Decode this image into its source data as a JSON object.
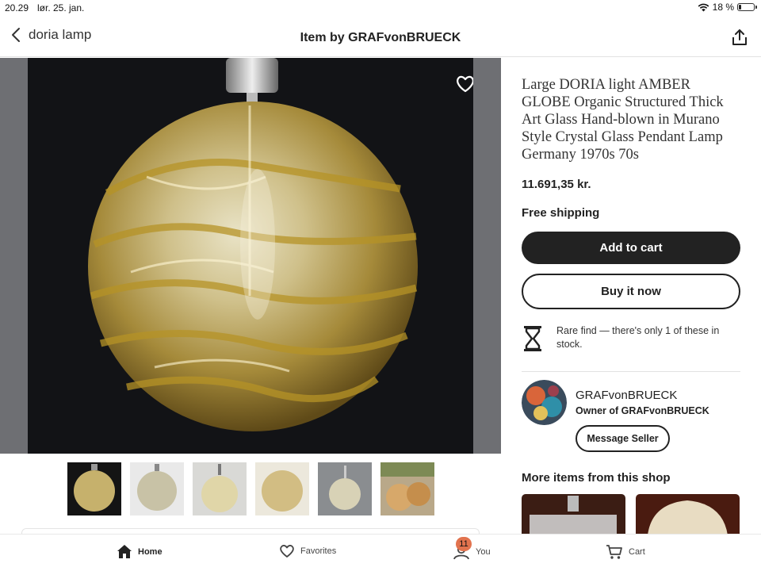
{
  "status_bar": {
    "time": "20.29",
    "date": "lør. 25. jan.",
    "battery_text": "18 %",
    "battery_level": 0.18
  },
  "header": {
    "back_label": "doria lamp",
    "title": "Item by GRAFvonBRUECK"
  },
  "product": {
    "title": "Large DORIA light AMBER GLOBE Organic Structured Thick Art Glass Hand-blown in Murano Style Crystal Glass  Pendant Lamp Germany 1970s 70s",
    "price": "11.691,35 kr.",
    "shipping": "Free shipping",
    "thumbnail_count": 6
  },
  "actions": {
    "add_to_cart": "Add to cart",
    "buy_now": "Buy it now"
  },
  "rare_notice": "Rare find — there's only 1 of these in stock.",
  "seller": {
    "name": "GRAFvonBRUECK",
    "role": "Owner of GRAFvonBRUECK",
    "message_label": "Message Seller"
  },
  "more_items": {
    "title": "More items from this shop"
  },
  "bottom_nav": {
    "items": [
      {
        "label": "Home",
        "icon": "home-icon",
        "active": true
      },
      {
        "label": "Favorites",
        "icon": "heart-icon"
      },
      {
        "label": "You",
        "icon": "user-icon",
        "badge": "11"
      },
      {
        "label": "Cart",
        "icon": "cart-icon"
      }
    ]
  },
  "colors": {
    "primary_button": "#222222",
    "badge": "#e2734e",
    "photo_background": "#121316",
    "amber": "#c9a84a"
  }
}
